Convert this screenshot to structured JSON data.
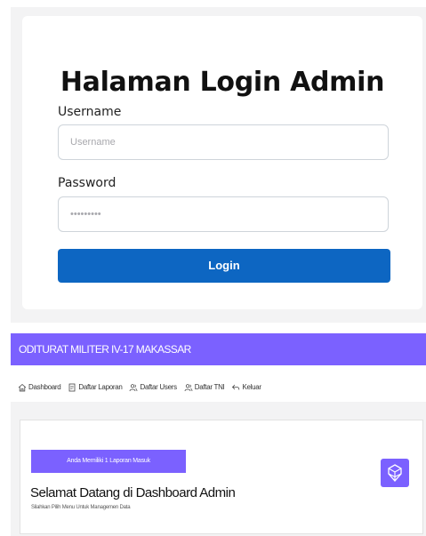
{
  "login": {
    "title": "Halaman Login Admin",
    "username_label": "Username",
    "username_placeholder": "Username",
    "password_label": "Password",
    "password_value": "•••••••••",
    "button_label": "Login"
  },
  "dashboard": {
    "brand": "ODITURAT MILITER IV-17 MAKASSAR",
    "menu": [
      {
        "icon": "home-icon",
        "label": "Dashboard"
      },
      {
        "icon": "document-icon",
        "label": "Daftar Laporan"
      },
      {
        "icon": "users-icon",
        "label": "Daftar Users"
      },
      {
        "icon": "users-icon",
        "label": "Daftar TNI"
      },
      {
        "icon": "logout-icon",
        "label": "Keluar"
      }
    ],
    "alert": "Anda Memiliki 1 Laporan Masuk",
    "welcome_title": "Selamat Datang di Dashboard Admin",
    "welcome_subtitle": "Silahkan Pilih Menu Untuk Managemen Data",
    "logo_icon": "dashboard-logo-icon"
  },
  "colors": {
    "accent": "#7b61ff",
    "button": "#0d66c2",
    "background": "#f3f3f4"
  }
}
